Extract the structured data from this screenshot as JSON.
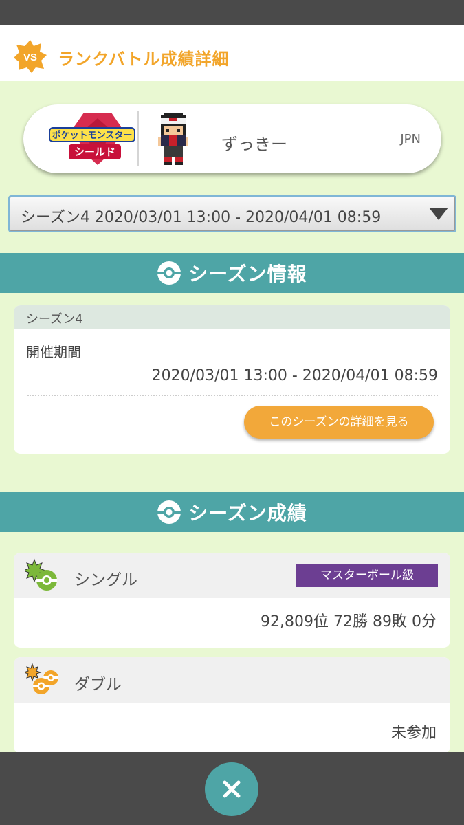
{
  "header": {
    "badge_text": "VS",
    "title": "ランクバトル成績詳細"
  },
  "profile": {
    "game_logo_line1": "ポケットモンスター",
    "game_logo_line2": "シールド",
    "player_name": "ずっきー",
    "region": "JPN"
  },
  "season_select": {
    "selected": "シーズン4 2020/03/01 13:00 - 2020/04/01 08:59"
  },
  "season_info": {
    "section_title": "シーズン情報",
    "card_title": "シーズン4",
    "period_label": "開催期間",
    "period_value": "2020/03/01 13:00 - 2020/04/01 08:59",
    "detail_button": "このシーズンの詳細を見る"
  },
  "season_results": {
    "section_title": "シーズン成績",
    "single": {
      "label": "シングル",
      "rank_badge": "マスターボール級",
      "result": "92,809位 72勝 89敗 0分"
    },
    "double": {
      "label": "ダブル",
      "result": "未参加"
    }
  },
  "colors": {
    "accent_orange": "#f2a52a",
    "teal": "#4ea5a6",
    "background_green": "#e9f8d2",
    "master_purple": "#6c3e92",
    "single_icon_green": "#7cb83a"
  },
  "icons": {
    "header": "vs-star-badge",
    "section": "poke-ball-icon",
    "single": "single-battle-icon",
    "double": "double-battle-icon",
    "dropdown": "dropdown-triangle",
    "close": "close-x-icon"
  }
}
